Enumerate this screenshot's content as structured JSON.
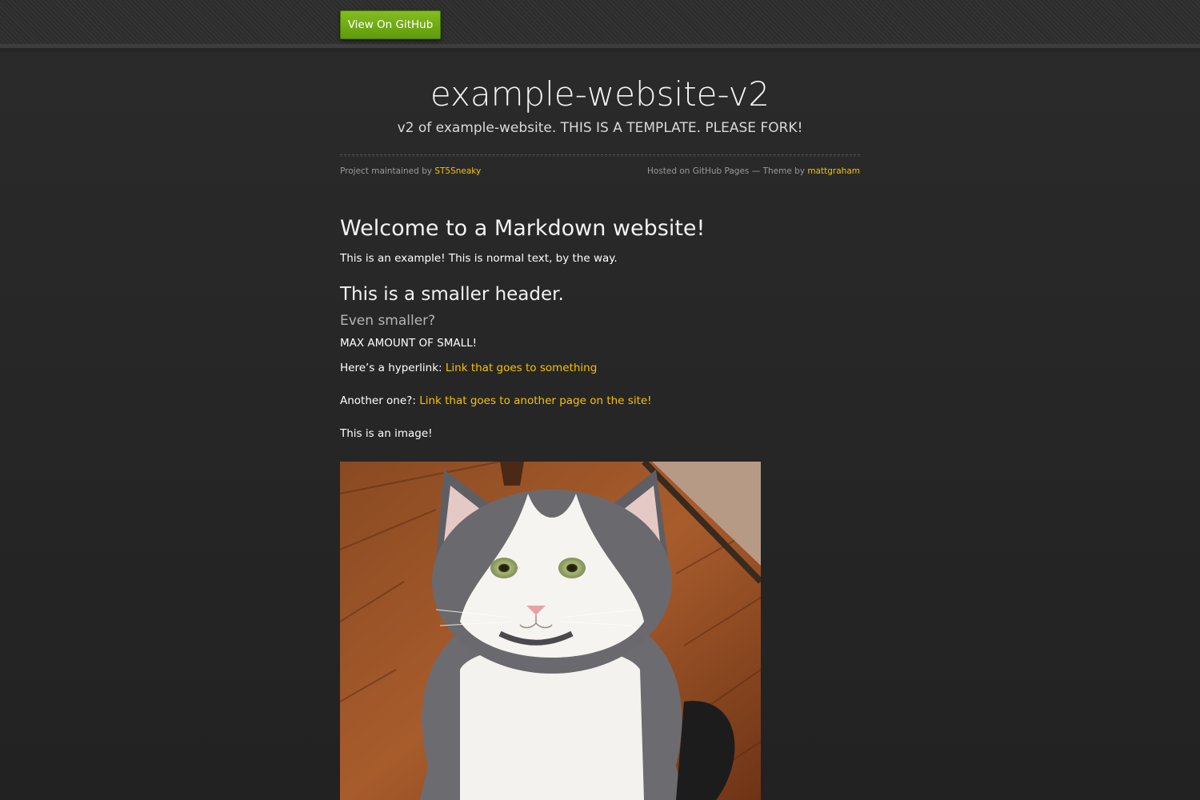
{
  "header": {
    "github_button": "View On GitHub"
  },
  "site": {
    "title": "example-website-v2",
    "subtitle": "v2 of example-website. THIS IS A TEMPLATE. PLEASE FORK!"
  },
  "meta": {
    "maintained_prefix": "Project maintained by ",
    "maintainer": "ST5Sneaky",
    "hosted_prefix": "Hosted on GitHub Pages — Theme by ",
    "theme_author": "mattgraham"
  },
  "content": {
    "heading1": "Welcome to a Markdown website!",
    "intro": "This is an example! This is normal text, by the way.",
    "heading2": "This is a smaller header.",
    "heading3": "Even smaller?",
    "small_text": "MAX AMOUNT OF SMALL!",
    "link1_prefix": "Here’s a hyperlink: ",
    "link1_text": "Link that goes to something",
    "link2_prefix": "Another one?: ",
    "link2_text": "Link that goes to another page on the site!",
    "image_label": "This is an image!"
  },
  "colors": {
    "accent": "#f6c100",
    "button": "#6fa91a",
    "background": "#262626"
  }
}
